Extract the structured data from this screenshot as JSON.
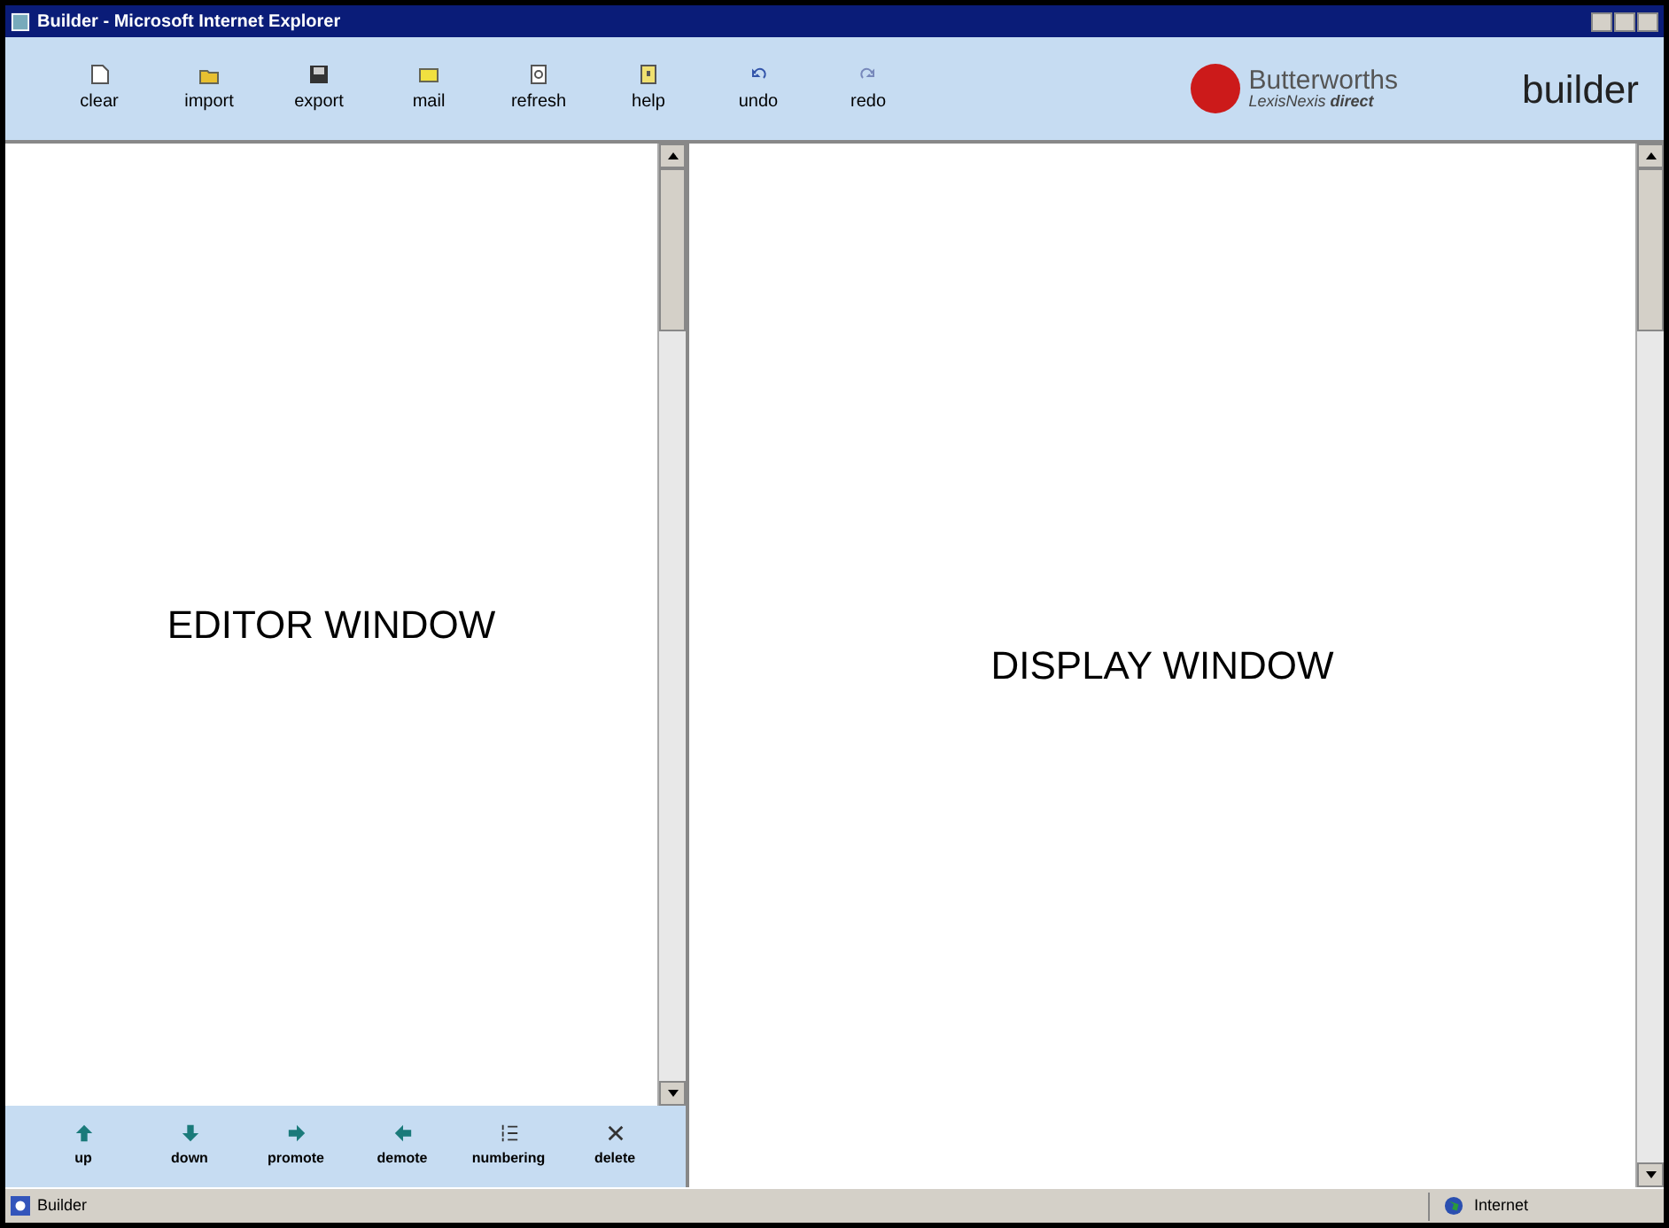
{
  "window": {
    "title": "Builder - Microsoft Internet Explorer"
  },
  "toolbar": [
    {
      "label": "clear"
    },
    {
      "label": "import"
    },
    {
      "label": "export"
    },
    {
      "label": "mail"
    },
    {
      "label": "refresh"
    },
    {
      "label": "help"
    },
    {
      "label": "undo"
    },
    {
      "label": "redo"
    }
  ],
  "logo": {
    "name": "Butterworths",
    "subtitle": "LexisNexis **direct**"
  },
  "app_title": "builder",
  "editor": {
    "text": "EDITOR WINDOW"
  },
  "display": {
    "text": "DISPLAY WINDOW"
  },
  "editor_toolbar": [
    {
      "label": "up"
    },
    {
      "label": "down"
    },
    {
      "label": "promote"
    },
    {
      "label": "demote"
    },
    {
      "label": "numbering"
    },
    {
      "label": "delete"
    }
  ],
  "status_bar": {
    "text": "Builder",
    "zone": "Internet"
  }
}
